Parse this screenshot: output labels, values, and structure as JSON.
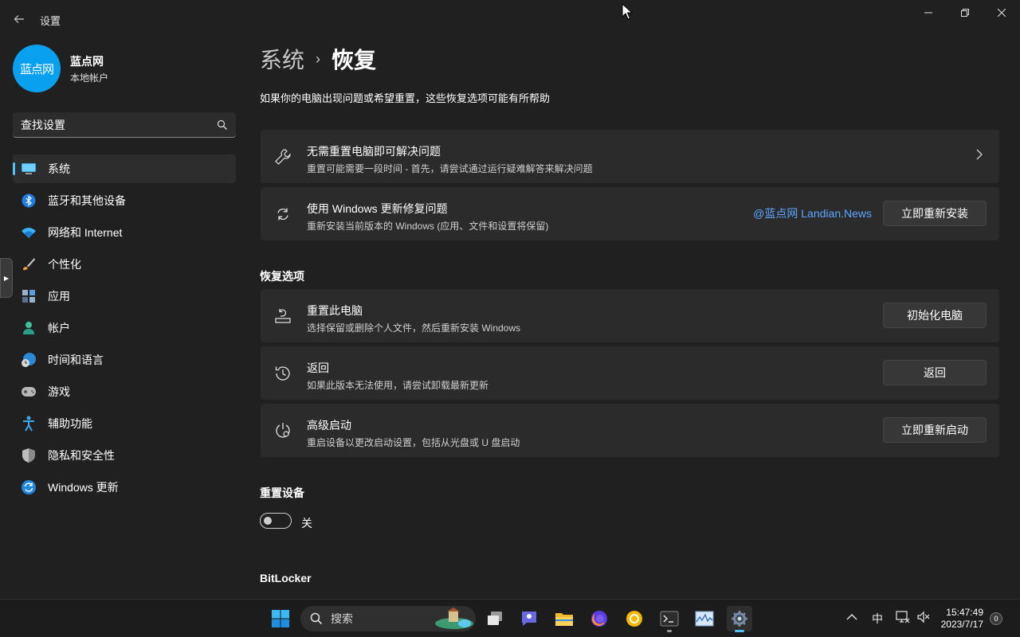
{
  "window": {
    "title": "设置"
  },
  "profile": {
    "avatar_text": "蓝点网",
    "name": "蓝点网",
    "account_type": "本地帐户"
  },
  "search": {
    "placeholder": "查找设置"
  },
  "sidebar": {
    "items": [
      {
        "label": "系统",
        "icon": "monitor-icon",
        "selected": true
      },
      {
        "label": "蓝牙和其他设备",
        "icon": "bluetooth-icon"
      },
      {
        "label": "网络和 Internet",
        "icon": "wifi-icon"
      },
      {
        "label": "个性化",
        "icon": "brush-icon"
      },
      {
        "label": "应用",
        "icon": "apps-icon"
      },
      {
        "label": "帐户",
        "icon": "person-icon"
      },
      {
        "label": "时间和语言",
        "icon": "globe-clock-icon"
      },
      {
        "label": "游戏",
        "icon": "gamepad-icon"
      },
      {
        "label": "辅助功能",
        "icon": "accessibility-icon"
      },
      {
        "label": "隐私和安全性",
        "icon": "shield-icon"
      },
      {
        "label": "Windows 更新",
        "icon": "update-icon"
      }
    ]
  },
  "breadcrumb": {
    "parent": "系统",
    "separator": "›",
    "current": "恢复"
  },
  "subtitle": "如果你的电脑出现问题或希望重置，这些恢复选项可能有所帮助",
  "cards": {
    "troubleshoot": {
      "title": "无需重置电脑即可解决问题",
      "desc": "重置可能需要一段时间 - 首先，请尝试通过运行疑难解答来解决问题"
    },
    "windows_update_fix": {
      "title": "使用 Windows 更新修复问题",
      "desc": "重新安装当前版本的 Windows (应用、文件和设置将保留)",
      "watermark": "@蓝点网 Landian.News",
      "button": "立即重新安装"
    }
  },
  "recovery_options": {
    "heading": "恢复选项",
    "reset_pc": {
      "title": "重置此电脑",
      "desc": "选择保留或删除个人文件，然后重新安装 Windows",
      "button": "初始化电脑"
    },
    "go_back": {
      "title": "返回",
      "desc": "如果此版本无法使用，请尝试卸载最新更新",
      "button": "返回"
    },
    "advanced_startup": {
      "title": "高级启动",
      "desc": "重启设备以更改启动设置，包括从光盘或 U 盘启动",
      "button": "立即重新启动"
    }
  },
  "reset_device": {
    "heading": "重置设备",
    "toggle_state": "关",
    "toggle_on": false
  },
  "bitlocker": {
    "heading": "BitLocker"
  },
  "taskbar": {
    "search_label": "搜索",
    "ime": "中",
    "time": "15:47:49",
    "date": "2023/7/17",
    "notification_count": "0"
  },
  "colors": {
    "accent": "#4cc2ff",
    "background": "#202020",
    "card": "#2b2b2b",
    "watermark": "#5ea6ff"
  }
}
